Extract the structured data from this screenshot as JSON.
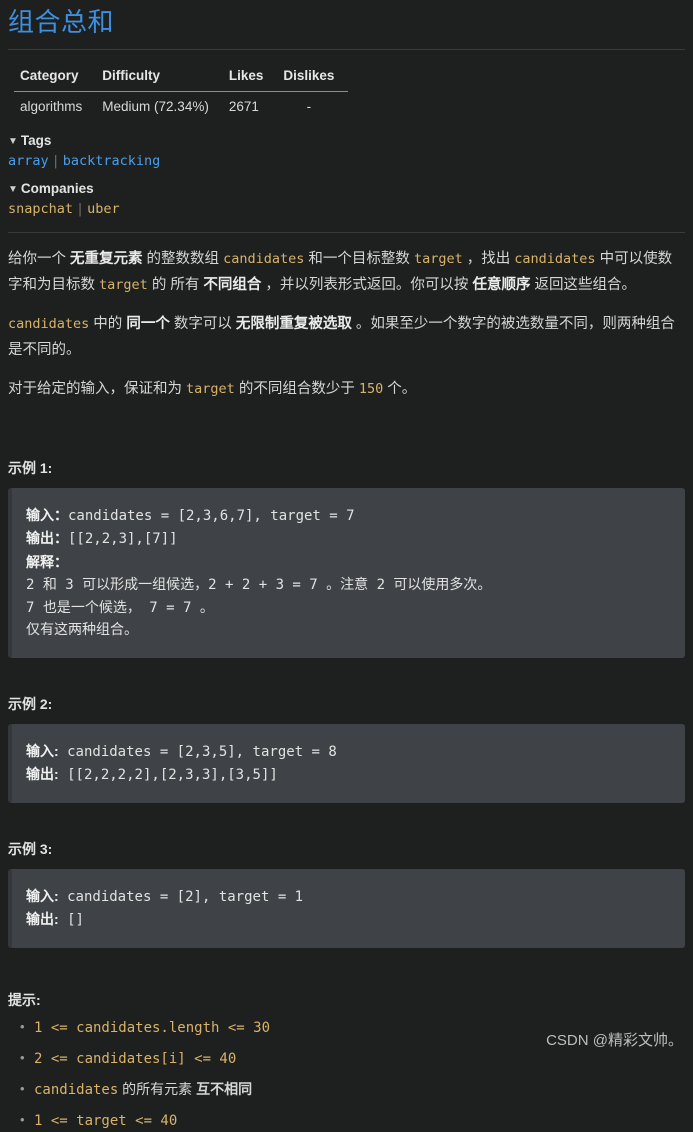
{
  "title": "组合总和",
  "meta_table": {
    "columns": [
      "Category",
      "Difficulty",
      "Likes",
      "Dislikes"
    ],
    "row": {
      "category": "algorithms",
      "difficulty": "Medium (72.34%)",
      "likes": "2671",
      "dislikes": "-"
    }
  },
  "tags": {
    "marker": "▼",
    "label": "Tags",
    "items": [
      "array",
      "backtracking"
    ],
    "separator": "|"
  },
  "companies": {
    "marker": "▼",
    "label": "Companies",
    "items": [
      "snapchat",
      "uber"
    ],
    "separator": "|"
  },
  "description": {
    "p1": {
      "s1": "给你一个 ",
      "b1": "无重复元素",
      "s2": " 的整数数组 ",
      "c1": "candidates",
      "s3": " 和一个目标整数 ",
      "c2": "target",
      "s4": " ，找出 ",
      "c3": "candidates",
      "s5": " 中可以使数字和为目标数 ",
      "c4": "target",
      "s6": " 的 所有 ",
      "b2": "不同组合",
      "s7": " ，并以列表形式返回。你可以按 ",
      "b3": "任意顺序",
      "s8": " 返回这些组合。"
    },
    "p2": {
      "c1": "candidates",
      "s1": " 中的 ",
      "b1": "同一个",
      "s2": " 数字可以 ",
      "b2": "无限制重复被选取",
      "s3": " 。如果至少一个数字的被选数量不同，则两种组合是不同的。"
    },
    "p3": {
      "s1": "对于给定的输入，保证和为 ",
      "c1": "target",
      "s2": " 的不同组合数少于 ",
      "c2": "150",
      "s3": " 个。"
    }
  },
  "examples": [
    {
      "heading": "示例 1:",
      "lines": [
        {
          "label": "输入：",
          "value": "candidates = [2,3,6,7], target = 7"
        },
        {
          "label": "输出：",
          "value": "[[2,2,3],[7]]"
        },
        {
          "label": "解释：",
          "value": ""
        },
        {
          "label": "",
          "value": "2 和 3 可以形成一组候选，2 + 2 + 3 = 7 。注意 2 可以使用多次。"
        },
        {
          "label": "",
          "value": "7 也是一个候选， 7 = 7 。"
        },
        {
          "label": "",
          "value": "仅有这两种组合。"
        }
      ]
    },
    {
      "heading": "示例 2:",
      "lines": [
        {
          "label": "输入:",
          "value": " candidates = [2,3,5], target = 8"
        },
        {
          "label": "输出:",
          "value": " [[2,2,2,2],[2,3,3],[3,5]]"
        }
      ]
    },
    {
      "heading": "示例 3:",
      "lines": [
        {
          "label": "输入:",
          "value": " candidates = [2], target = 1"
        },
        {
          "label": "输出:",
          "value": " []"
        }
      ]
    }
  ],
  "hints": {
    "heading": "提示:",
    "items": [
      {
        "code1": "1 <= candidates.length <= 30",
        "text": "",
        "bold": ""
      },
      {
        "code1": "2 <= candidates[i] <= 40",
        "text": "",
        "bold": ""
      },
      {
        "code1": "candidates",
        "text": " 的所有元素 ",
        "bold": "互不相同"
      },
      {
        "code1": "1 <= target <= 40",
        "text": "",
        "bold": ""
      }
    ]
  },
  "watermark": "CSDN @精彩文帅。",
  "colors": {
    "page_bg": "#1e1f1f",
    "title_blue": "#3d8fe0",
    "code_tan": "#d8b36a",
    "codeblock_bg": "#3f4347",
    "link_blue": "#4a9eea"
  }
}
